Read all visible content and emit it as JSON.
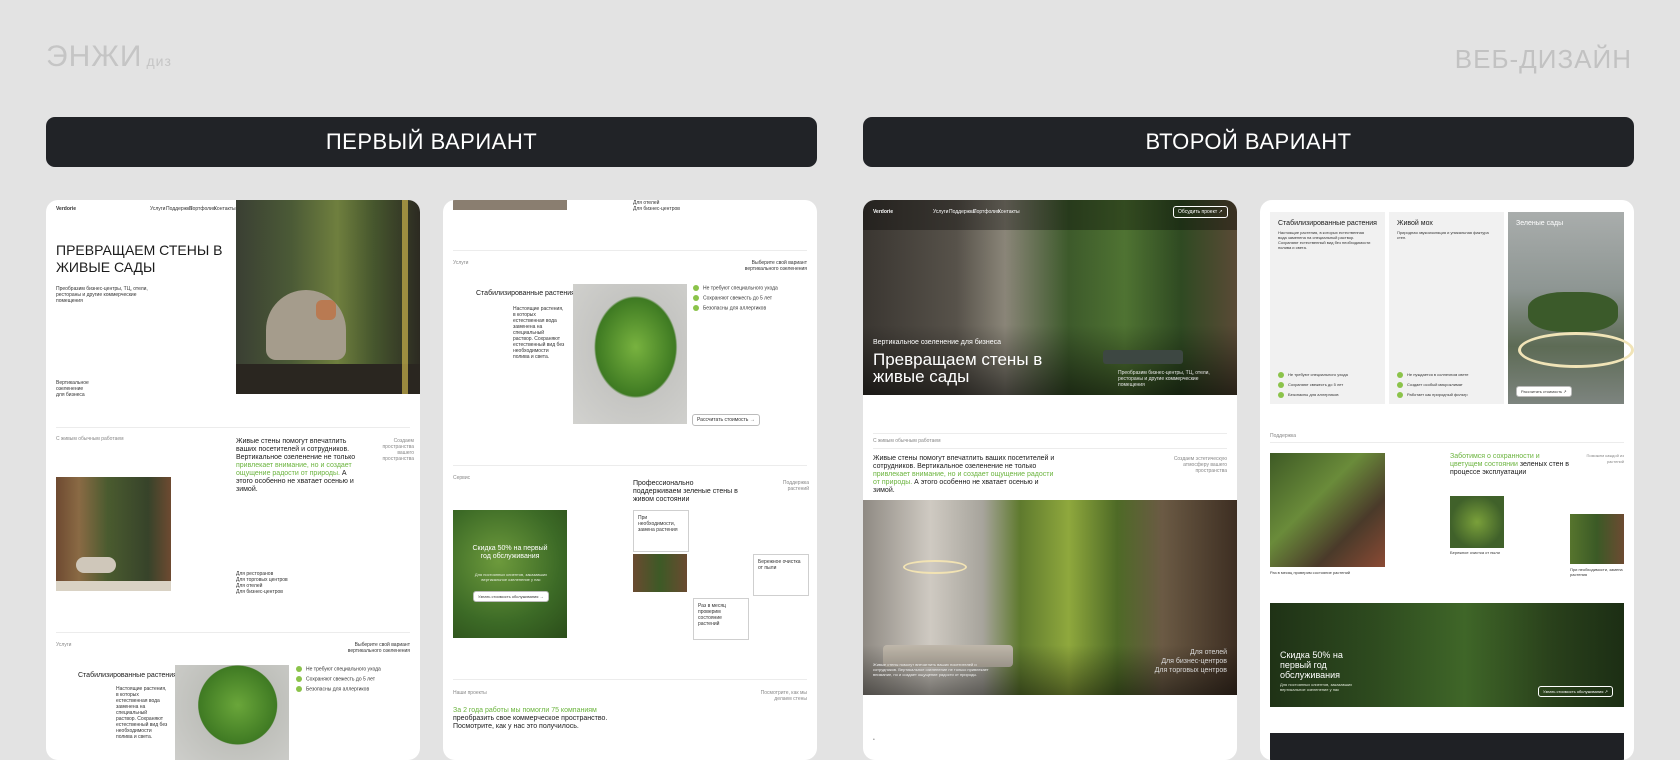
{
  "brand": {
    "logo": "ЭНЖИ",
    "logo_sub": "диз",
    "tagline": "ВЕБ-ДИЗАЙН"
  },
  "headers": {
    "first": "ПЕРВЫЙ ВАРИАНТ",
    "second": "ВТОРОЙ ВАРИАНТ"
  },
  "v1": {
    "nav_logo": "Verdorie",
    "nav": [
      "Услуги",
      "Поддержка",
      "Портфолио",
      "Контакты"
    ],
    "hero_title": "ПРЕВРАЩАЕМ СТЕНЫ В ЖИВЫЕ САДЫ",
    "hero_sub": "Преобразим бизнес-центры, ТЦ, отели, рестораны и другие коммерческие помещения",
    "hero_side": "Вертикальное озеленение для бизнеса",
    "s2_label": "С живым обычным работаем",
    "s2_right": "Создаем пространства вашего пространства",
    "s2_text_a": "Живые стены помогут впечатлить ваших посетителей и сотрудников. Вертикальное озеленение не только",
    "s2_text_green": "привлекает внимание, но и создает ощущение радости от природы.",
    "s2_text_b": "А этого особенно не хватает осенью и зимой.",
    "list": [
      "Для ресторанов",
      "Для торговых центров",
      "Для отелей",
      "Для бизнес-центров"
    ],
    "s3_label": "Услуги",
    "s3_right": "Выберите свой вариант вертикального озеленения",
    "s3_title": "Стабилизированные растения",
    "s3_desc": "Настоящие растения, в которых естественная вода заменена на специальный раствор. Сохраняют естественный вид без необходимости полива и света.",
    "s3_points": [
      "Не требуют специального ухода",
      "Сохраняют свежесть до 5 лет",
      "Безопасны для аллергиков"
    ]
  },
  "v2col": {
    "top_list": [
      "Для отелей",
      "Для бизнес-центров"
    ],
    "s_label": "Услуги",
    "s_right": "Выберите свой вариант вертикального озеленения",
    "s_title": "Стабилизированные растения",
    "s_desc": "Настоящие растения, в которых естественная вода заменена на специальный раствор. Сохраняют естественный вид без необходимости полива и света.",
    "s_points": [
      "Не требуют специального ухода",
      "Сохраняют свежесть до 5 лет",
      "Безопасны для аллергиков"
    ],
    "s_btn": "Рассчитать стоимость →",
    "sup_label": "Сервис",
    "sup_right": "Поддержка растений",
    "sup_title": "Профессионально поддерживаем зеленые стены в живом состоянии",
    "sup_cards": [
      "При необходимости, замена растения",
      "Бережное очистка от пыли",
      "Раз в месяц проверим состояние растений"
    ],
    "promo_title": "Скидка 50% на первый год обслуживания",
    "promo_sub": "Для постоянных клиентов, заказавших вертикальное озеленение у нас",
    "promo_btn": "Узнать стоимость обслуживания →",
    "port_label": "Наши проекты",
    "port_right": "Посмотрите, как мы делаем стены",
    "port_green": "За 2 года работы мы помогли 75 компаниям",
    "port_text": "преобразить свое коммерческое пространство. Посмотрите, как у нас это получилось."
  },
  "v3": {
    "nav_logo": "Verdorie",
    "nav": [
      "Услуги",
      "Поддержка",
      "Портфолио",
      "Контакты"
    ],
    "nav_btn": "Обсудить проект ↗",
    "hero_kicker": "Вертикальное озеленение для бизнеса",
    "hero_title": "Превращаем стены в живые сады",
    "hero_sub": "Преобразим бизнес-центры, ТЦ, отели, рестораны и другие коммерческие помещения",
    "s2_label": "С живым обычным работаем",
    "s2_right": "Создаем эстетическую атмосферу вашего пространства",
    "s2_text_a": "Живые стены помогут впечатлить ваших посетителей и сотрудников. Вертикальное озеленение не только",
    "s2_text_green": "привлекает внимание, но и создает ощущение радости от природы.",
    "s2_text_b": "А этого особенно не хватает осенью и зимой.",
    "img_caption": "Живые стены помогут впечатлить ваших посетителей и сотрудников. Вертикальное озеленение не только привлекает внимание, но и создает ощущение радости от природы.",
    "img_list": [
      "Для отелей",
      "Для бизнес-центров",
      "Для торговых центров"
    ]
  },
  "v4": {
    "c1_title": "Стабилизированные растения",
    "c1_desc": "Настоящие растения, в которых естественная вода заменена на специальный раствор. Сохраняют естественный вид без необходимости полива и света.",
    "c1_points": [
      "Не требуют специального ухода",
      "Сохраняют свежесть до 5 лет",
      "Безопасны для аллергиков"
    ],
    "c2_title": "Живой мох",
    "c2_desc": "Природная звукоизоляция и уникальная фактура стен.",
    "c2_points": [
      "Не нуждается в солнечном свете",
      "Создает особый микроклимат",
      "Работает как природный фильтр"
    ],
    "c3_title": "Зеленые сады",
    "c3_btn": "Рассчитать стоимость ↗",
    "sup_label": "Поддержка",
    "sup_title_green": "Заботимся о сохранности и цветущем состоянии",
    "sup_title": "зеленых стен в процессе эксплуатации",
    "sup_right": "Поможем каждой из растений",
    "sup_cap1": "Раз в месяц проверим состояние растений",
    "sup_cap2": "Бережное очистка от пыли",
    "sup_cap3": "При необходимости, замена растения",
    "promo_title": "Скидка 50% на первый год обслуживания",
    "promo_sub": "Для постоянных клиентов, заказавших вертикальное озеленение у нас",
    "promo_btn": "Узнать стоимость обслуживания ↗"
  }
}
